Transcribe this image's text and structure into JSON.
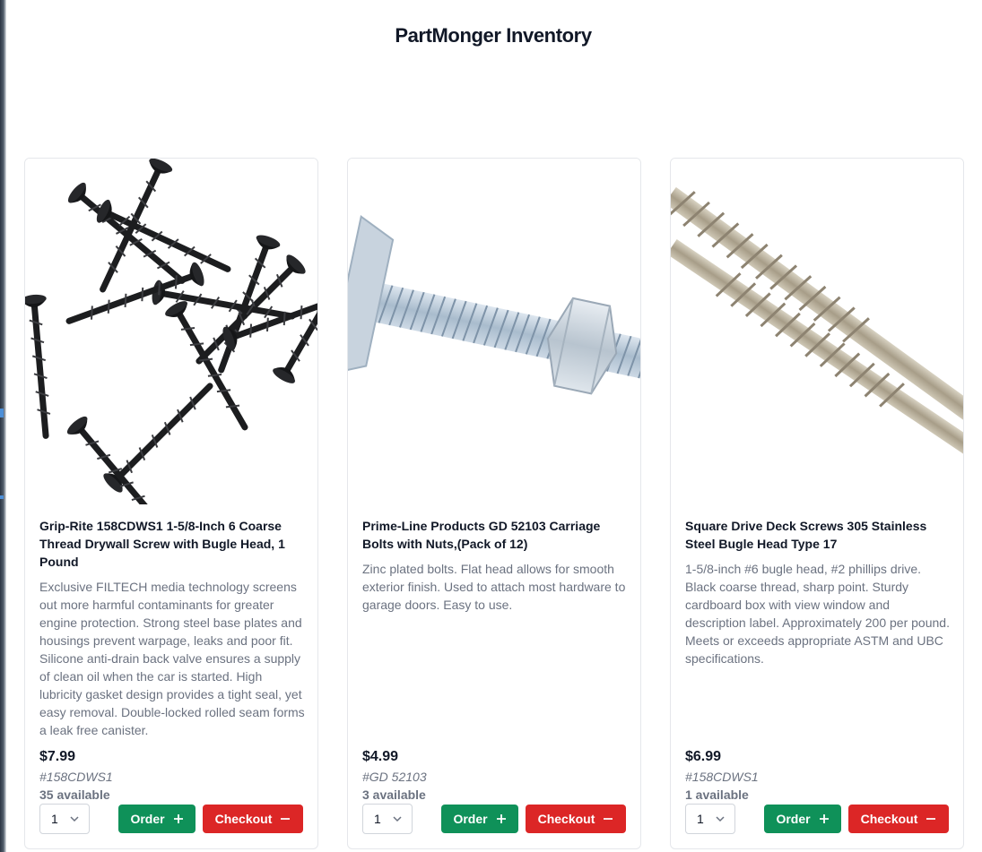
{
  "page": {
    "title": "PartMonger Inventory"
  },
  "products": [
    {
      "title": "Grip-Rite 158CDWS1 1-5/8-Inch 6 Coarse Thread Drywall Screw with Bugle Head, 1 Pound",
      "description": "Exclusive FILTECH media technology screens out more harmful contaminants for greater engine protection. Strong steel base plates and housings prevent warpage, leaks and poor fit. Silicone anti-drain back valve ensures a supply of clean oil when the car is started. High lubricity gasket design provides a tight seal, yet easy removal. Double-locked rolled seam forms a leak free canister.",
      "price": "$7.99",
      "sku": "#158CDWS1",
      "availability": "35 available",
      "quantity": "1",
      "order_label": "Order",
      "checkout_label": "Checkout",
      "image_alt": "black drywall screws"
    },
    {
      "title": "Prime-Line Products GD 52103 Carriage Bolts with Nuts,(Pack of 12)",
      "description": "Zinc plated bolts. Flat head allows for smooth exterior finish. Used to attach most hardware to garage doors. Easy to use.",
      "price": "$4.99",
      "sku": "#GD 52103",
      "availability": "3 available",
      "quantity": "1",
      "order_label": "Order",
      "checkout_label": "Checkout",
      "image_alt": "zinc carriage bolt with nut"
    },
    {
      "title": "Square Drive Deck Screws 305 Stainless Steel Bugle Head Type 17",
      "description": "1-5/8-inch #6 bugle head, #2 phillips drive. Black coarse thread, sharp point. Sturdy cardboard box with view window and description label. Approximately 200 per pound. Meets or exceeds appropriate ASTM and UBC specifications.",
      "price": "$6.99",
      "sku": "#158CDWS1",
      "availability": "1 available",
      "quantity": "1",
      "order_label": "Order",
      "checkout_label": "Checkout",
      "image_alt": "stainless steel deck screws"
    }
  ],
  "colors": {
    "order": "#0f9159",
    "checkout": "#dc2626",
    "muted_text": "#6b7280"
  },
  "icons": {
    "order": "plus-icon",
    "checkout": "minus-icon",
    "select": "chevron-down-icon"
  }
}
